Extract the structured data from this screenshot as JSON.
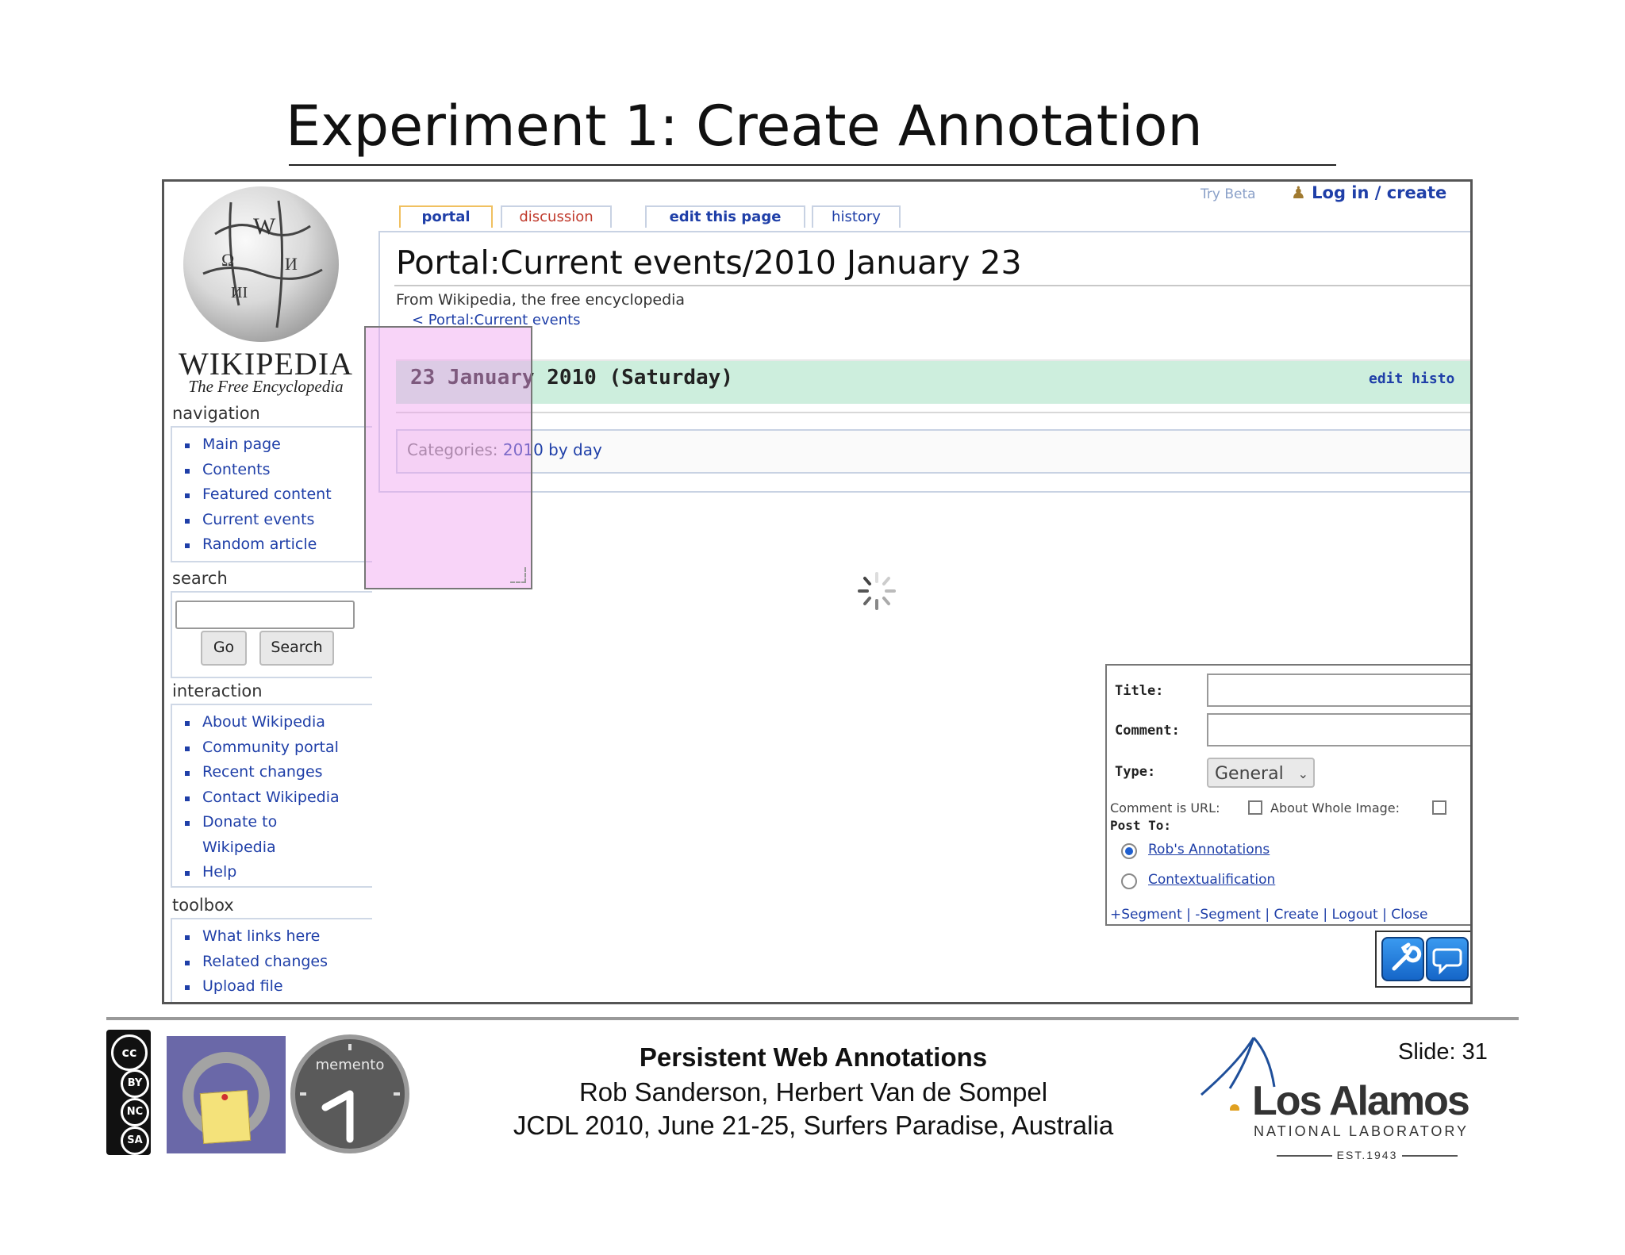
{
  "slide": {
    "title": "Experiment 1: Create Annotation",
    "number": "Slide: 31"
  },
  "wiki": {
    "logo_word": "WIKIPEDIA",
    "logo_tagline": "The Free Encyclopedia",
    "tabs": [
      "portal",
      "discussion",
      "edit this page",
      "history"
    ],
    "try_beta": "Try Beta",
    "login": "Log in / create",
    "page_heading": "Portal:Current events/2010 January 23",
    "from": "From Wikipedia, the free encyclopedia",
    "back_link": "< Portal:Current events",
    "day_heading": "23 January 2010 (Saturday)",
    "day_actions": "edit histo",
    "categories_prefix": "Categories:",
    "categories_value": "2010 by day",
    "navigation": {
      "heading": "navigation",
      "items": [
        "Main page",
        "Contents",
        "Featured content",
        "Current events",
        "Random article"
      ]
    },
    "search": {
      "heading": "search",
      "go": "Go",
      "search_button": "Search"
    },
    "interaction": {
      "heading": "interaction",
      "items": [
        "About Wikipedia",
        "Community portal",
        "Recent changes",
        "Contact Wikipedia",
        "Donate to Wikipedia",
        "Help"
      ]
    },
    "toolbox": {
      "heading": "toolbox",
      "items": [
        "What links here",
        "Related changes",
        "Upload file"
      ]
    }
  },
  "annotation_panel": {
    "title_label": "Title:",
    "comment_label": "Comment:",
    "type_label": "Type:",
    "type_value": "General",
    "comment_is_url": "Comment is URL:",
    "about_whole_image": "About Whole Image:",
    "post_to": "Post To:",
    "targets": [
      "Rob's Annotations",
      "Contextualification"
    ],
    "selected_target": "Rob's Annotations",
    "actions": "+Segment | -Segment | Create | Logout | Close"
  },
  "footer": {
    "title": "Persistent Web Annotations",
    "authors": "Rob Sanderson, Herbert Van de Sompel",
    "conference": "JCDL 2010, June 21-25, Surfers Paradise, Australia",
    "license": [
      "BY",
      "NC",
      "SA"
    ],
    "memento_label": "memento",
    "lab_name": "Los Alamos",
    "lab_sub": "NATIONAL LABORATORY",
    "lab_est": "EST.1943"
  },
  "colors": {
    "link": "#1f3fa8",
    "day_bar": "#cdeedd",
    "selection": "#f0a0f0",
    "tool_button": "#1566c8"
  }
}
